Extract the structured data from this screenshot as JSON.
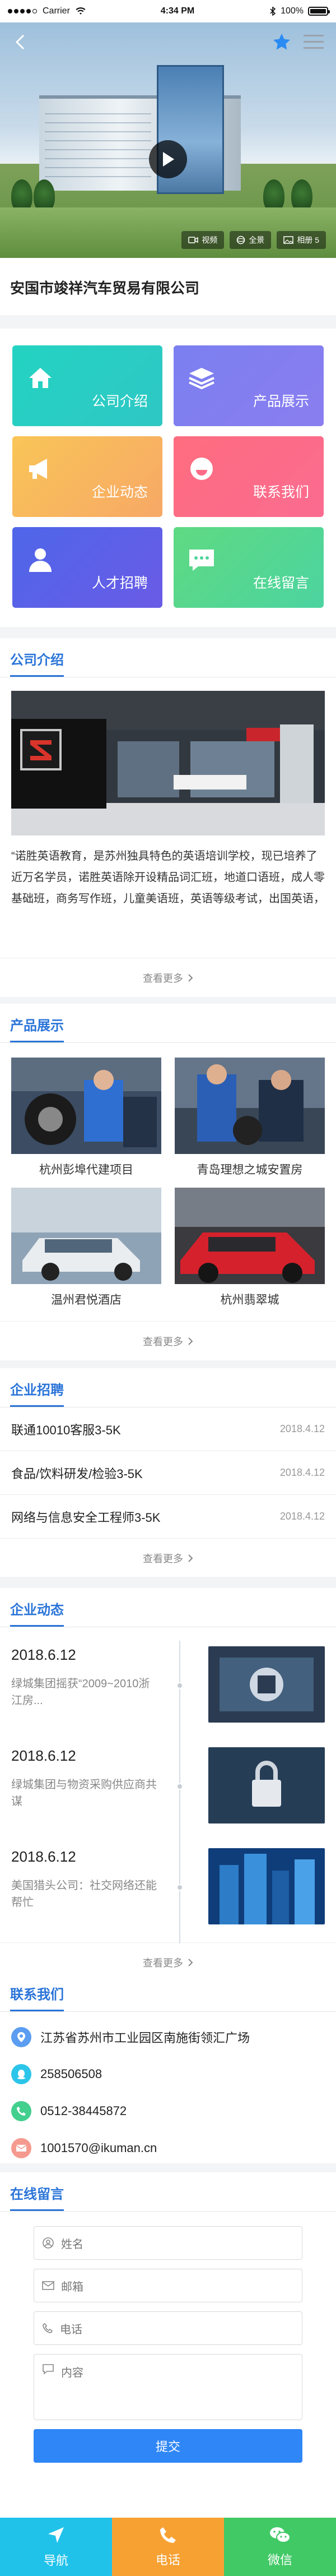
{
  "status_bar": {
    "carrier": "Carrier",
    "time": "4:34 PM",
    "battery": "100%"
  },
  "hero": {
    "tabs": [
      {
        "icon": "video-icon",
        "label": "视频"
      },
      {
        "icon": "panorama-icon",
        "label": "全景"
      },
      {
        "icon": "album-icon",
        "label": "相册 5"
      }
    ]
  },
  "company": {
    "name": "安国市竣祥汽车贸易有限公司"
  },
  "quick_menu": [
    {
      "label": "公司介绍",
      "icon": "home-icon"
    },
    {
      "label": "产品展示",
      "icon": "layers-icon"
    },
    {
      "label": "企业动态",
      "icon": "megaphone-icon"
    },
    {
      "label": "联系我们",
      "icon": "smile-icon"
    },
    {
      "label": "人才招聘",
      "icon": "user-icon"
    },
    {
      "label": "在线留言",
      "icon": "chat-icon"
    }
  ],
  "intro": {
    "title": "公司介绍",
    "text": "“诺胜英语教育，是苏州独具特色的英语培训学校，现已培养了近万名学员，诺胜英语除开设精品词汇班，地道口语班，成人零基础班，商务写作班，儿童美语班，英语等级考试，出国英语，雅思考试等，还设有MBA考前辅导…",
    "more": "查看更多"
  },
  "products": {
    "title": "产品展示",
    "items": [
      {
        "caption": "杭州彭埠代建项目"
      },
      {
        "caption": "青岛理想之城安置房"
      },
      {
        "caption": "温州君悦酒店"
      },
      {
        "caption": "杭州翡翠城"
      }
    ],
    "more": "查看更多"
  },
  "jobs": {
    "title": "企业招聘",
    "items": [
      {
        "title": "联通10010客服3-5K",
        "date": "2018.4.12"
      },
      {
        "title": "食品/饮料研发/检验3-5K",
        "date": "2018.4.12"
      },
      {
        "title": "网络与信息安全工程师3-5K",
        "date": "2018.4.12"
      }
    ],
    "more": "查看更多"
  },
  "news": {
    "title": "企业动态",
    "items": [
      {
        "date": "2018.6.12",
        "desc": "绿城集团摇获“2009~2010浙江房..."
      },
      {
        "date": "2018.6.12",
        "desc": "绿城集团与物资采购供应商共谋"
      },
      {
        "date": "2018.6.12",
        "desc": "美国猎头公司：社交网络还能帮忙"
      }
    ],
    "more": "查看更多"
  },
  "contact": {
    "title": "联系我们",
    "items": [
      {
        "icon": "location-icon",
        "text": "江苏省苏州市工业园区南施街领汇广场",
        "color": "#5b9df0"
      },
      {
        "icon": "qq-icon",
        "text": "258506508",
        "color": "#2cc5ea"
      },
      {
        "icon": "phone-icon",
        "text": "0512-38445872",
        "color": "#43cf8e"
      },
      {
        "icon": "mail-icon",
        "text": "1001570@ikuman.cn",
        "color": "#f59a8f"
      }
    ]
  },
  "message": {
    "title": "在线留言",
    "name_placeholder": "姓名",
    "email_placeholder": "邮箱",
    "phone_placeholder": "电话",
    "content_placeholder": "内容",
    "submit": "提交"
  },
  "bottom_nav": [
    {
      "label": "导航",
      "icon": "navigation-icon"
    },
    {
      "label": "电话",
      "icon": "phone-icon"
    },
    {
      "label": "微信",
      "icon": "wechat-icon"
    }
  ]
}
